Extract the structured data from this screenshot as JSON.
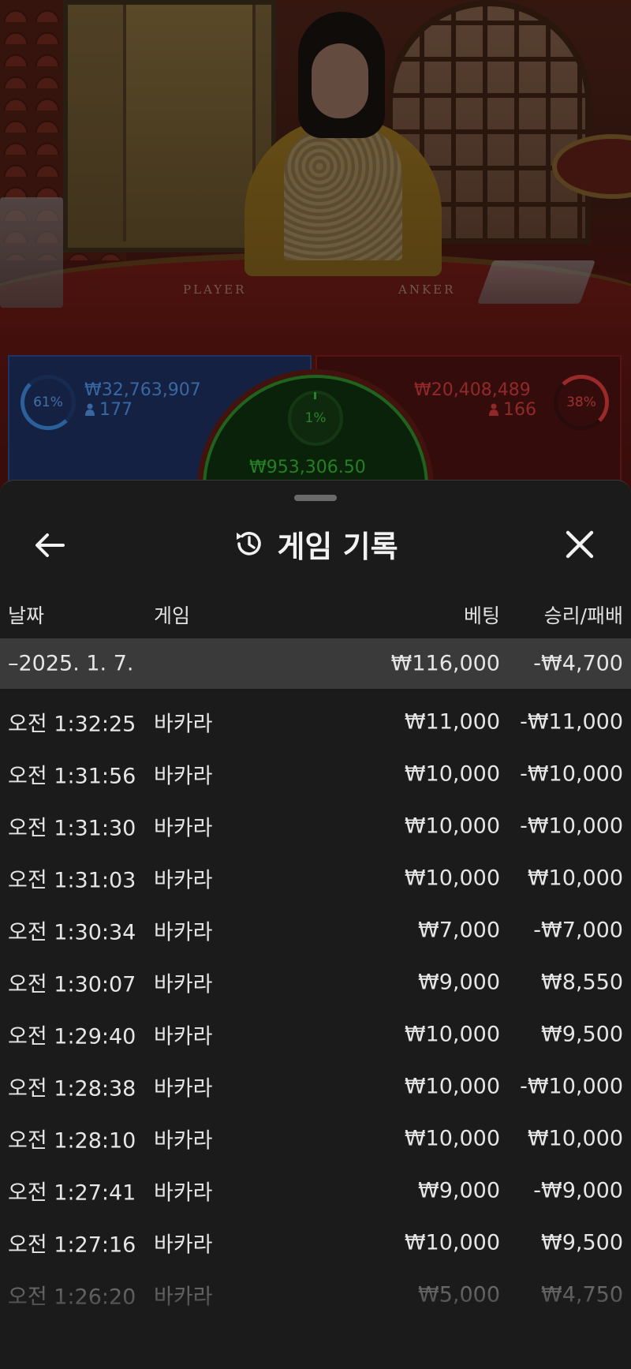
{
  "video": {
    "felt_left_label": "PLAYER",
    "felt_right_label": "ANKER"
  },
  "bets": {
    "player": {
      "percent": "61%",
      "amount": "₩32,763,907",
      "count": "177",
      "color": "#4f8fe0"
    },
    "tie": {
      "percent": "1%",
      "amount": "₩953,306.50",
      "color": "#34b032"
    },
    "banker": {
      "percent": "38%",
      "amount": "₩20,408,489",
      "count": "166",
      "color": "#c93a3a"
    }
  },
  "sheet": {
    "title": "게임 기록",
    "icons": {
      "back": "arrow-left-icon",
      "history": "history-icon",
      "close": "close-icon"
    },
    "columns": {
      "date": "날짜",
      "game": "게임",
      "bet": "베팅",
      "result": "승리/패배"
    },
    "date_group": {
      "label": "–2025. 1. 7.",
      "bet": "₩116,000",
      "result": "-₩4,700"
    },
    "rows": [
      {
        "time": "오전 1:32:25",
        "game": "바카라",
        "bet": "₩11,000",
        "result": "-₩11,000"
      },
      {
        "time": "오전 1:31:56",
        "game": "바카라",
        "bet": "₩10,000",
        "result": "-₩10,000"
      },
      {
        "time": "오전 1:31:30",
        "game": "바카라",
        "bet": "₩10,000",
        "result": "-₩10,000"
      },
      {
        "time": "오전 1:31:03",
        "game": "바카라",
        "bet": "₩10,000",
        "result": "₩10,000"
      },
      {
        "time": "오전 1:30:34",
        "game": "바카라",
        "bet": "₩7,000",
        "result": "-₩7,000"
      },
      {
        "time": "오전 1:30:07",
        "game": "바카라",
        "bet": "₩9,000",
        "result": "₩8,550"
      },
      {
        "time": "오전 1:29:40",
        "game": "바카라",
        "bet": "₩10,000",
        "result": "₩9,500"
      },
      {
        "time": "오전 1:28:38",
        "game": "바카라",
        "bet": "₩10,000",
        "result": "-₩10,000"
      },
      {
        "time": "오전 1:28:10",
        "game": "바카라",
        "bet": "₩10,000",
        "result": "₩10,000"
      },
      {
        "time": "오전 1:27:41",
        "game": "바카라",
        "bet": "₩9,000",
        "result": "-₩9,000"
      },
      {
        "time": "오전 1:27:16",
        "game": "바카라",
        "bet": "₩10,000",
        "result": "₩9,500"
      },
      {
        "time": "오전 1:26:20",
        "game": "바카라",
        "bet": "₩5,000",
        "result": "₩4,750"
      }
    ]
  }
}
